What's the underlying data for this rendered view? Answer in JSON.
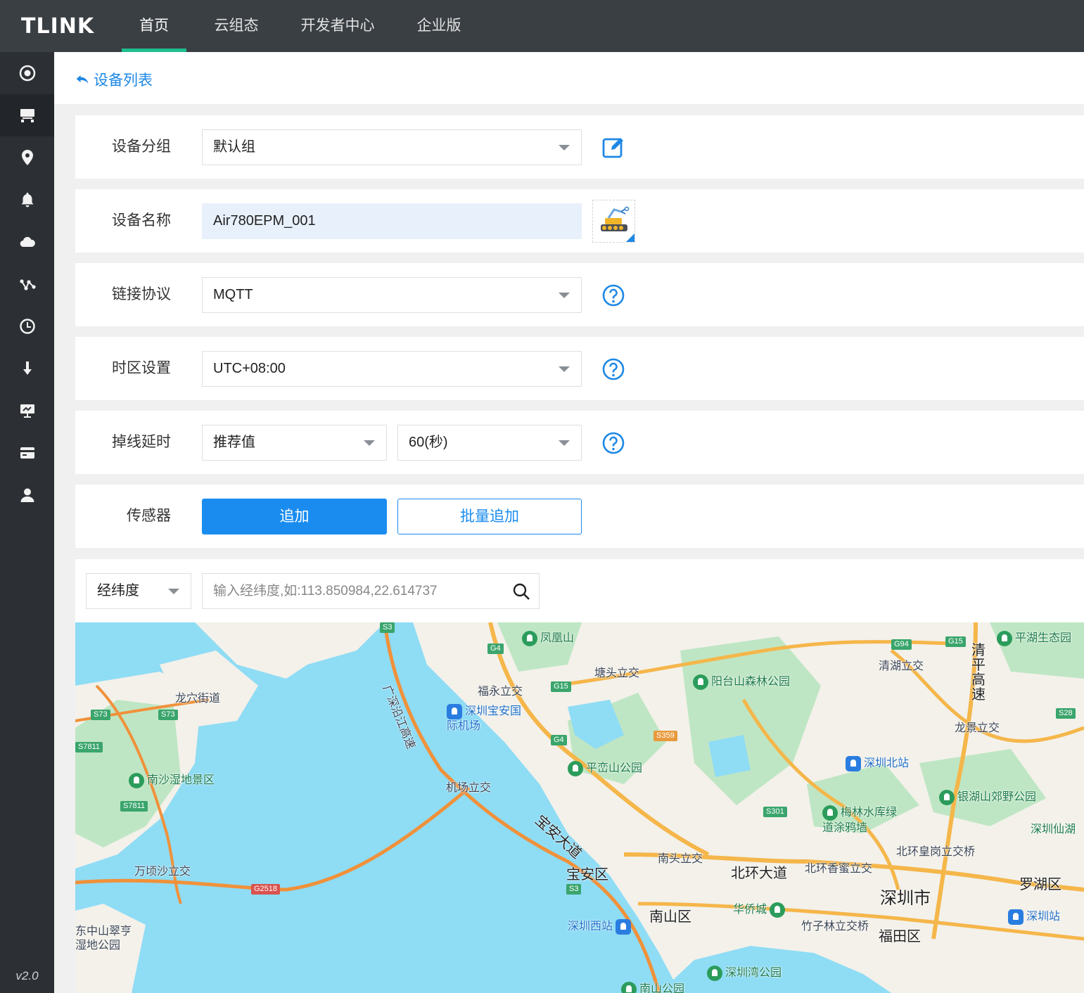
{
  "app": {
    "logo": "TLINK",
    "version": "v2.0"
  },
  "nav": {
    "items": [
      {
        "label": "首页",
        "active": true
      },
      {
        "label": "云组态",
        "active": false
      },
      {
        "label": "开发者中心",
        "active": false
      },
      {
        "label": "企业版",
        "active": false
      }
    ],
    "accent": "#1fbf8f"
  },
  "sidebar": {
    "items": [
      {
        "icon": "dashboard-icon",
        "active": false
      },
      {
        "icon": "device-icon",
        "active": true
      },
      {
        "icon": "location-pin-icon",
        "active": false
      },
      {
        "icon": "bell-icon",
        "active": false
      },
      {
        "icon": "cloud-icon",
        "active": false
      },
      {
        "icon": "network-icon",
        "active": false
      },
      {
        "icon": "clock-icon",
        "active": false
      },
      {
        "icon": "download-icon",
        "active": false
      },
      {
        "icon": "presentation-icon",
        "active": false
      },
      {
        "icon": "card-icon",
        "active": false
      },
      {
        "icon": "user-icon",
        "active": false
      }
    ]
  },
  "breadcrumb": {
    "back_label": "设备列表"
  },
  "form": {
    "group": {
      "label": "设备分组",
      "value": "默认组"
    },
    "name": {
      "label": "设备名称",
      "value": "Air780EPM_001"
    },
    "protocol": {
      "label": "链接协议",
      "value": "MQTT"
    },
    "timezone": {
      "label": "时区设置",
      "value": "UTC+08:00"
    },
    "offline": {
      "label": "掉线延时",
      "mode": "推荐值",
      "value": "60(秒)"
    },
    "sensor": {
      "label": "传感器",
      "add_label": "追加",
      "batch_label": "批量追加"
    }
  },
  "map_search": {
    "type": "经纬度",
    "placeholder": "输入经纬度,如:113.850984,22.614737"
  },
  "map": {
    "labels": {
      "fenghuang": "凤凰山",
      "guangshen": "广深沿江高速",
      "tangtou": "塘头立交",
      "fuyong": "福永立交",
      "airport": "深圳宝安国际机场",
      "yangtai": "阳台山森林公园",
      "longxue": "龙穴街道",
      "nansha": "南沙湿地景区",
      "pingluan": "平峦山公园",
      "jichang": "机场立交",
      "baoan_ave": "宝安大道",
      "wanqingsha": "万顷沙立交",
      "zhongshan": "东中山翠亨湿地公园",
      "baoan": "宝安区",
      "nantou": "南头立交",
      "beihuan": "北环大道",
      "nanshan": "南山区",
      "szwest": "深圳西站",
      "huaqiao": "华侨城",
      "szbay": "深圳湾公园",
      "nanshan_park": "南山公园",
      "qinghu": "清湖立交",
      "pinghu": "平湖生态园",
      "qingping": "清平高速",
      "longjing": "龙景立交",
      "sznorth": "深圳北站",
      "yinhu": "银湖山郊野公园",
      "meilin": "梅林水库绿道涂鸦墙",
      "xianhu": "深圳仙湖",
      "huanggang": "北环皇岗立交桥",
      "xiangmi": "北环香蜜立交",
      "szcity": "深圳市",
      "luohu": "罗湖区",
      "zhuzilin": "竹子林立交桥",
      "futian": "福田区",
      "szstation": "深圳站"
    },
    "shields": [
      "S3",
      "G4",
      "G15",
      "G4",
      "S359",
      "S73",
      "S73",
      "S7811",
      "S7811",
      "G2518",
      "S3",
      "S301",
      "G94",
      "G15",
      "S28"
    ],
    "colors": {
      "water": "#8fdcf5",
      "land": "#f3f1ea",
      "green": "#bfe6c4",
      "road_main": "#f5b64a",
      "road_highway": "#f0913a"
    }
  }
}
